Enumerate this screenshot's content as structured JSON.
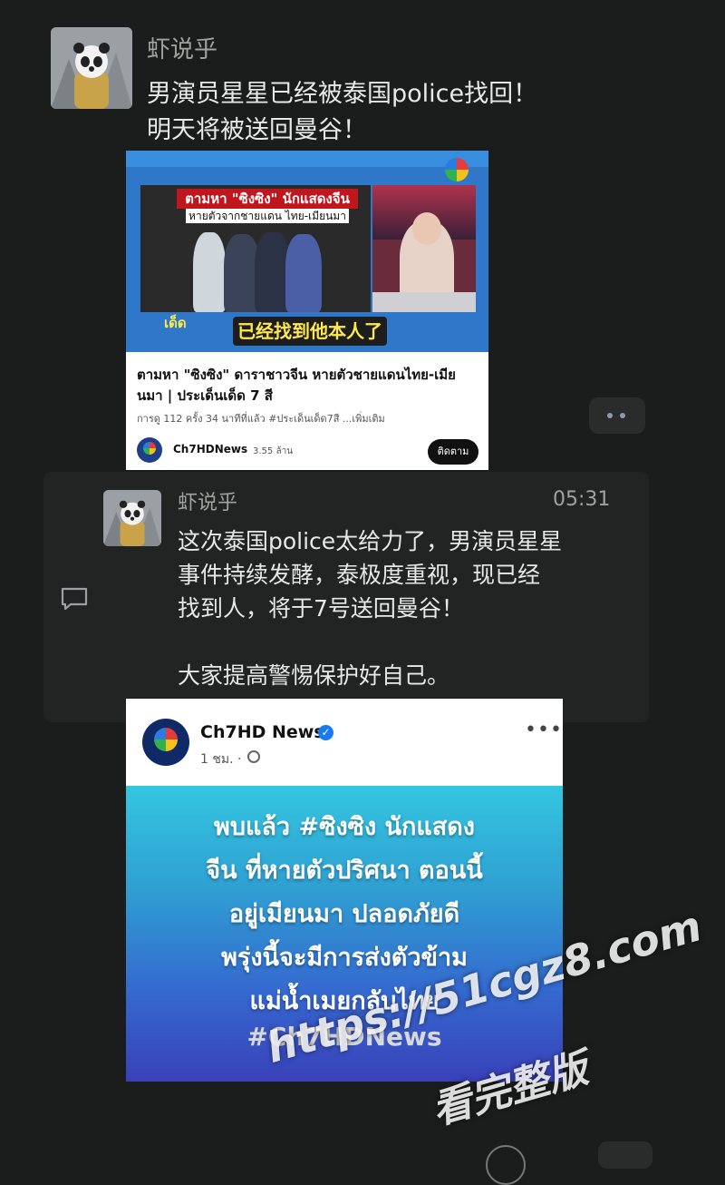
{
  "message1": {
    "sender": "虾说乎",
    "text_line1": "男演员星星已经被泰国police找回！",
    "text_line2": "明天将被送回曼谷！"
  },
  "video_card": {
    "banner_title": "ตามหา \"ซิงซิง\" นักแสดงจีน",
    "banner_sub": "หายตัวจากชายแดน ไทย-เมียนมา",
    "caption": "已经找到他本人了",
    "program_logo": "เด็ด",
    "title": "ตามหา \"ซิงซิง\" ดาราชาวจีน หายตัวชายแดนไทย-เมียนมา | ประเด็นเด็ด 7 สี",
    "meta": "การดู 112 ครั้ง   34 นาทีที่แล้ว  #ประเด็นเด็ด7สี  ...เพิ่มเติม",
    "channel": "Ch7HDNews",
    "subscribers": "3.55 ล้าน",
    "subscribe_label": "ติดตาม"
  },
  "message2": {
    "sender": "虾说乎",
    "time": "05:31",
    "line1": "这次泰国police太给力了，男演员星星",
    "line2": "事件持续发酵，泰极度重视，现已经",
    "line3": "找到人，将于7号送回曼谷！",
    "line4": "大家提高警惕保护好自己。"
  },
  "fb_post": {
    "page_name": "Ch7HD News",
    "time": "1 ชม. · ",
    "text_line1": "พบแล้ว #ซิงซิง นักแสดง",
    "text_line2": "จีน ที่หายตัวปริศนา ตอนนี้",
    "text_line3": "อยู่เมียนมา ปลอดภัยดี",
    "text_line4": "พรุ่งนี้จะมีการส่งตัวข้าม",
    "text_line5": "แม่น้ำเมยกลับไทย",
    "hashtag": "#Ch7HDNews"
  },
  "watermark": {
    "url": "https://51cgz8.com",
    "tagline": "看完整版"
  },
  "icons": {
    "more": "more-dots-icon",
    "comment": "comment-icon",
    "verified": "verified-badge-icon",
    "globe": "audience-globe-icon"
  },
  "colors": {
    "background": "#1b1d1c",
    "verified_blue": "#1877f2",
    "caption_yellow": "#ffe94a",
    "news_red": "#c0161e"
  }
}
